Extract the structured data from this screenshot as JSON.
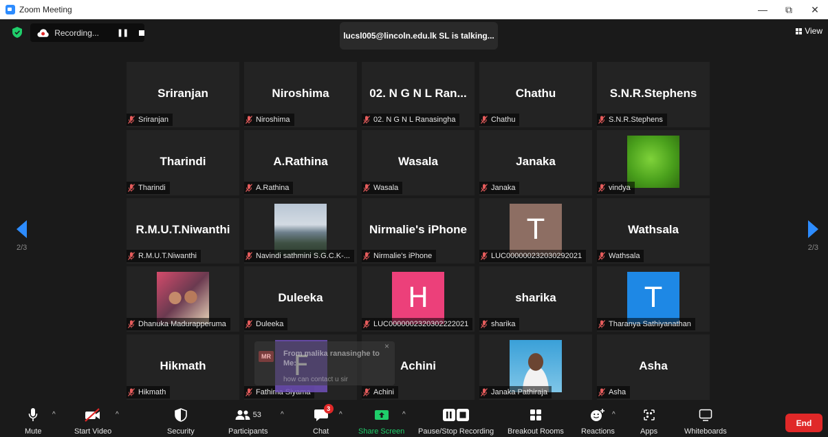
{
  "window": {
    "title": "Zoom Meeting"
  },
  "topbar": {
    "recording_label": "Recording...",
    "talking_text": "lucsl005@lincoln.edu.lk SL is talking...",
    "view_label": "View"
  },
  "pagination": {
    "left_page": "2/3",
    "right_page": "2/3"
  },
  "tiles": [
    {
      "display": "Sriranjan",
      "label": "Sriranjan"
    },
    {
      "display": "Niroshima",
      "label": "Niroshima"
    },
    {
      "display": "02. N G N L Ran...",
      "label": "02. N G N L Ranasingha"
    },
    {
      "display": "Chathu",
      "label": "Chathu"
    },
    {
      "display": "S.N.R.Stephens",
      "label": "S.N.R.Stephens"
    },
    {
      "display": "Tharindi",
      "label": "Tharindi"
    },
    {
      "display": "A.Rathina",
      "label": "A.Rathina"
    },
    {
      "display": "Wasala",
      "label": "Wasala"
    },
    {
      "display": "Janaka",
      "label": "Janaka"
    },
    {
      "display": "",
      "label": "vindya"
    },
    {
      "display": "R.M.U.T.Niwanthi",
      "label": "R.M.U.T.Niwanthi"
    },
    {
      "display": "",
      "label": "Navindi sathmini S.G.C.K-..."
    },
    {
      "display": "Nirmalie's iPhone",
      "label": "Nirmalie's iPhone"
    },
    {
      "display": "T",
      "label": "LUC000000232030292021"
    },
    {
      "display": "Wathsala",
      "label": "Wathsala"
    },
    {
      "display": "",
      "label": "Dhanuka Madurapperuma"
    },
    {
      "display": "Duleeka",
      "label": "Duleeka"
    },
    {
      "display": "H",
      "label": "LUC0000002320302222021"
    },
    {
      "display": "sharika",
      "label": "sharika"
    },
    {
      "display": "T",
      "label": "Tharanya Sathiyanathan"
    },
    {
      "display": "Hikmath",
      "label": "Hikmath"
    },
    {
      "display": "F",
      "label": "Fathima Siyama"
    },
    {
      "display": "Achini",
      "label": "Achini"
    },
    {
      "display": "",
      "label": "Janaka Pathiraja"
    },
    {
      "display": "Asha",
      "label": "Asha"
    }
  ],
  "chat_popup": {
    "initials": "MR",
    "from": "From malika ranasinghe to Me:",
    "message": "how can contact u sir",
    "close": "×"
  },
  "toolbar": {
    "mute": "Mute",
    "start_video": "Start Video",
    "security": "Security",
    "participants": "Participants",
    "participants_count": "53",
    "chat": "Chat",
    "chat_badge": "3",
    "share_screen": "Share Screen",
    "pause_stop_recording": "Pause/Stop Recording",
    "breakout_rooms": "Breakout Rooms",
    "reactions": "Reactions",
    "apps": "Apps",
    "whiteboards": "Whiteboards",
    "end": "End"
  },
  "colors": {
    "accent_blue": "#2d8cff",
    "end_red": "#e02828",
    "share_green": "#1fce6a",
    "avatar_T1": "#8d6e63",
    "avatar_H": "#ec407a",
    "avatar_T2": "#1e88e5",
    "avatar_F": "#7050ba"
  }
}
